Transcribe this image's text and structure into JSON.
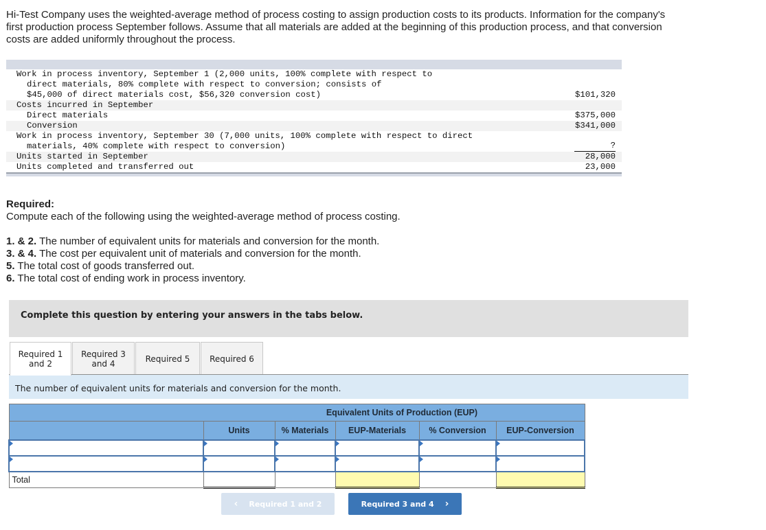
{
  "intro": "Hi-Test Company uses the weighted-average method of process costing to assign production costs to its products. Information for the company's first production process September follows. Assume that all materials are added at the beginning of this production process, and that conversion costs are added uniformly throughout the process.",
  "data_table": {
    "rows": [
      {
        "lines": [
          "Work in process inventory, September 1 (2,000 units, 100% complete with respect to",
          "direct materials, 80% complete with respect to conversion; consists of",
          "$45,000 of direct materials cost, $56,320 conversion cost)"
        ],
        "value": "$101,320"
      },
      {
        "lines": [
          "Costs incurred in September"
        ],
        "value": ""
      },
      {
        "lines": [
          "Direct materials"
        ],
        "value": "$375,000",
        "indent": true
      },
      {
        "lines": [
          "Conversion"
        ],
        "value": "$341,000",
        "indent": true
      },
      {
        "lines": [
          "Work in process inventory, September 30 (7,000 units, 100% complete with respect to direct",
          "materials, 40% complete with respect to conversion)"
        ],
        "value": "?"
      },
      {
        "lines": [
          "Units started in September"
        ],
        "value": "28,000"
      },
      {
        "lines": [
          "Units completed and transferred out"
        ],
        "value": "23,000"
      }
    ]
  },
  "required": {
    "heading": "Required:",
    "instruction": "Compute each of the following using the weighted-average method of process costing.",
    "items": [
      {
        "num": "1. & 2.",
        "text": " The number of equivalent units for materials and conversion for the month."
      },
      {
        "num": "3. & 4.",
        "text": " The cost per equivalent unit of materials and conversion for the month."
      },
      {
        "num": "5.",
        "text": " The total cost of goods transferred out."
      },
      {
        "num": "6.",
        "text": " The total cost of ending work in process inventory."
      }
    ]
  },
  "complete_banner": "Complete this question by entering your answers in the tabs below.",
  "tabs": [
    {
      "label_line1": "Required 1",
      "label_line2": "and 2",
      "active": true
    },
    {
      "label_line1": "Required 3",
      "label_line2": "and 4",
      "active": false
    },
    {
      "label_line1": "Required 5",
      "label_line2": "",
      "active": false
    },
    {
      "label_line1": "Required 6",
      "label_line2": "",
      "active": false
    }
  ],
  "tab_description": "The number of equivalent units for materials and conversion for the month.",
  "eup_table": {
    "group_header": "Equivalent Units of Production (EUP)",
    "columns": [
      "Units",
      "% Materials",
      "EUP-Materials",
      "% Conversion",
      "EUP-Conversion"
    ],
    "rows": [
      {
        "label": "",
        "units": "",
        "pct_materials": "",
        "eup_materials": "",
        "pct_conversion": "",
        "eup_conversion": ""
      },
      {
        "label": "",
        "units": "",
        "pct_materials": "",
        "eup_materials": "",
        "pct_conversion": "",
        "eup_conversion": ""
      }
    ],
    "total_label": "Total",
    "total": {
      "units": "",
      "eup_materials": "",
      "eup_conversion": ""
    }
  },
  "nav": {
    "prev_label": "Required 1 and 2",
    "next_label": "Required 3 and 4",
    "prev_icon": "chevron-left-icon",
    "next_icon": "chevron-right-icon"
  },
  "colors": {
    "table_header": "#7aaee0",
    "input_border": "#4a75aa",
    "total_highlight": "#fffbb0",
    "next_button": "#3b76b7",
    "prev_button_disabled": "#d8e3f0",
    "tab_description_bg": "#dbeaf6"
  }
}
